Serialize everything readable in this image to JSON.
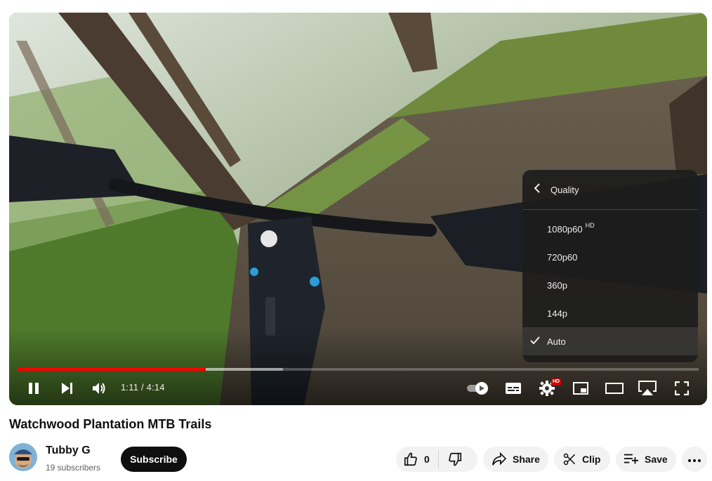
{
  "player": {
    "time_current": "1:11",
    "time_separator": " / ",
    "time_total": "4:14",
    "progress_played": 0.276,
    "progress_buffered": 0.39,
    "hd_badge": "HD",
    "quality_menu": {
      "title": "Quality",
      "options": [
        {
          "label": "1080p60",
          "badge": "HD"
        },
        {
          "label": "720p60",
          "badge": ""
        },
        {
          "label": "360p",
          "badge": ""
        },
        {
          "label": "144p",
          "badge": ""
        },
        {
          "label": "Auto",
          "badge": ""
        }
      ],
      "selected": "Auto"
    },
    "icons": [
      "pause-icon",
      "next-icon",
      "volume-icon",
      "autoplay-toggle",
      "subtitles-icon",
      "settings-gear-icon",
      "miniplayer-icon",
      "theater-mode-icon",
      "airplay-icon",
      "fullscreen-icon"
    ]
  },
  "video": {
    "title": "Watchwood Plantation MTB Trails"
  },
  "channel": {
    "name": "Tubby G",
    "subscribers": "19 subscribers",
    "subscribe_label": "Subscribe"
  },
  "actions": {
    "like_count": "0",
    "share_label": "Share",
    "clip_label": "Clip",
    "save_label": "Save"
  },
  "colors": {
    "progress_played": "#ff0000",
    "hd_badge": "#cc0000",
    "subscribe_bg": "#0f0f0f",
    "pill_bg": "#f2f2f2"
  }
}
